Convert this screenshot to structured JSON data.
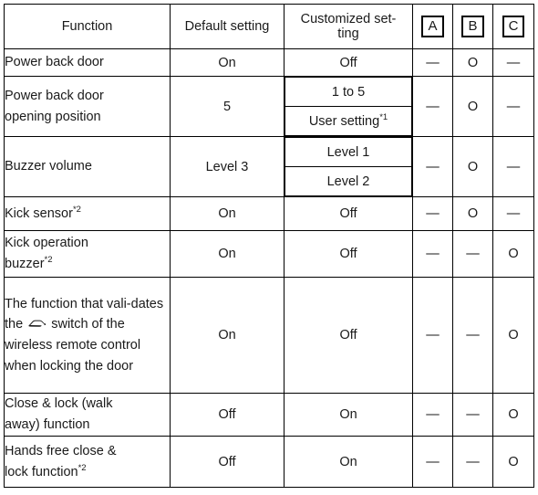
{
  "table": {
    "headers": {
      "function": "Function",
      "default_setting": "Default setting",
      "customized_setting": "Customized set-ting",
      "customized_setting_line1": "Customized set-",
      "customized_setting_line2": "ting",
      "col_a": "A",
      "col_b": "B",
      "col_c": "C"
    },
    "marks": {
      "dash": "—",
      "circle": "O"
    },
    "footnote_markers": {
      "one": "*1",
      "two": "*2"
    },
    "rows": [
      {
        "function": "Power back door",
        "default": "On",
        "customized": [
          "Off"
        ],
        "a": "—",
        "b": "O",
        "c": "—"
      },
      {
        "function": "Power back door opening position",
        "function_line1": "Power back door",
        "function_line2": "opening position",
        "default": "5",
        "customized": [
          "1 to 5",
          "User setting"
        ],
        "customized_sup": [
          null,
          "*1"
        ],
        "a": "—",
        "b": "O",
        "c": "—"
      },
      {
        "function": "Buzzer volume",
        "default": "Level 3",
        "customized": [
          "Level 1",
          "Level 2"
        ],
        "a": "—",
        "b": "O",
        "c": "—"
      },
      {
        "function": "Kick sensor",
        "function_sup": "*2",
        "default": "On",
        "customized": [
          "Off"
        ],
        "a": "—",
        "b": "O",
        "c": "—"
      },
      {
        "function": "Kick operation buzzer",
        "function_line1": "Kick operation",
        "function_line2": "buzzer",
        "function_sup": "*2",
        "default": "On",
        "customized": [
          "Off"
        ],
        "a": "—",
        "b": "—",
        "c": "O"
      },
      {
        "function": "The function that validates the [back door] switch of the wireless remote control when locking the door",
        "function_part1": "The function that vali-dates the ",
        "function_icon": "back-door-switch-icon",
        "function_part2": " switch of the wireless remote control when locking the door",
        "default": "On",
        "customized": [
          "Off"
        ],
        "a": "—",
        "b": "—",
        "c": "O"
      },
      {
        "function": "Close & lock (walk away) function",
        "function_line1": "Close & lock (walk",
        "function_line2": "away) function",
        "default": "Off",
        "customized": [
          "On"
        ],
        "a": "—",
        "b": "—",
        "c": "O"
      },
      {
        "function": "Hands free close & lock function",
        "function_line1": "Hands free close &",
        "function_line2": "lock function",
        "function_sup": "*2",
        "default": "Off",
        "customized": [
          "On"
        ],
        "a": "—",
        "b": "—",
        "c": "O"
      }
    ]
  },
  "colors": {
    "header_background": "#d5d5d5",
    "border": "#000000",
    "text": "#1a1a1a",
    "cell_background": "#ffffff"
  }
}
